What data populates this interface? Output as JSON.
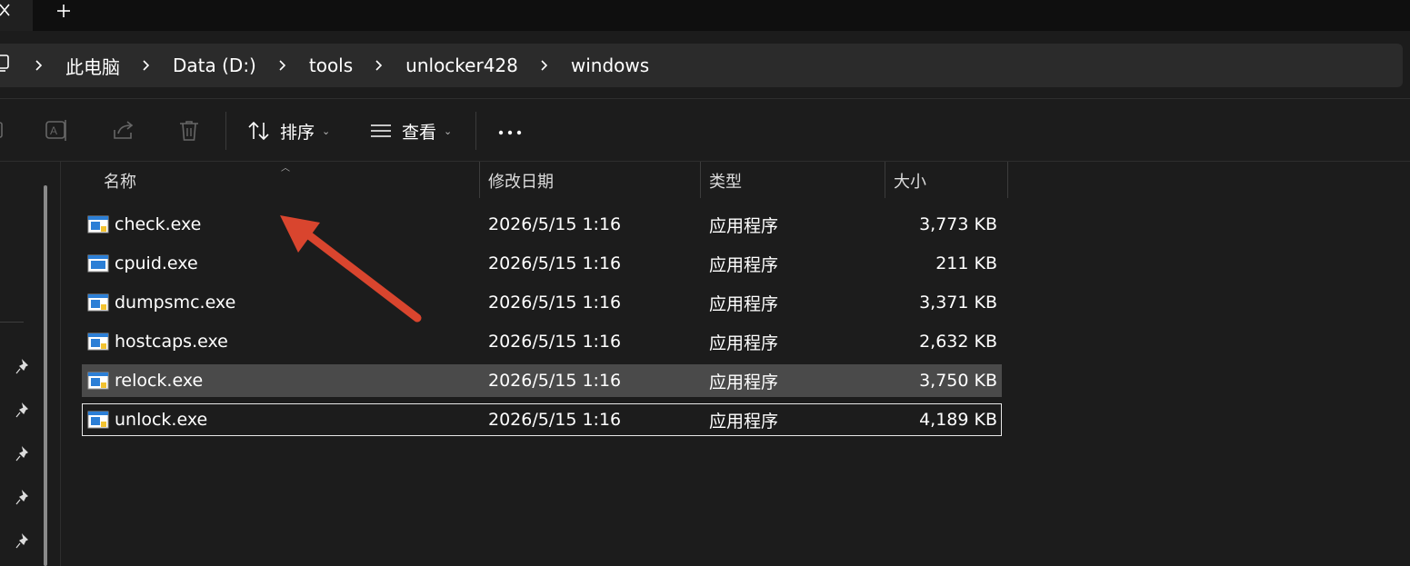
{
  "tabbar": {
    "close_icon": "close-icon",
    "add_icon": "plus-icon"
  },
  "address": {
    "crumbs": [
      "此电脑",
      "Data (D:)",
      "tools",
      "unlocker428",
      "windows"
    ]
  },
  "toolbar": {
    "sort_label": "排序",
    "view_label": "查看",
    "more_icon": "more-icon"
  },
  "columns": {
    "name": "名称",
    "modified": "修改日期",
    "type": "类型",
    "size": "大小"
  },
  "files": [
    {
      "name": "check.exe",
      "modified": "2026/5/15 1:16",
      "type": "应用程序",
      "size": "3,773 KB"
    },
    {
      "name": "cpuid.exe",
      "modified": "2026/5/15 1:16",
      "type": "应用程序",
      "size": "211 KB"
    },
    {
      "name": "dumpsmc.exe",
      "modified": "2026/5/15 1:16",
      "type": "应用程序",
      "size": "3,371 KB"
    },
    {
      "name": "hostcaps.exe",
      "modified": "2026/5/15 1:16",
      "type": "应用程序",
      "size": "2,632 KB"
    },
    {
      "name": "relock.exe",
      "modified": "2026/5/15 1:16",
      "type": "应用程序",
      "size": "3,750 KB"
    },
    {
      "name": "unlock.exe",
      "modified": "2026/5/15 1:16",
      "type": "应用程序",
      "size": "4,189 KB"
    }
  ],
  "colors": {
    "annotation_arrow": "#d9452e",
    "selected_row": "#4a4a4a"
  }
}
